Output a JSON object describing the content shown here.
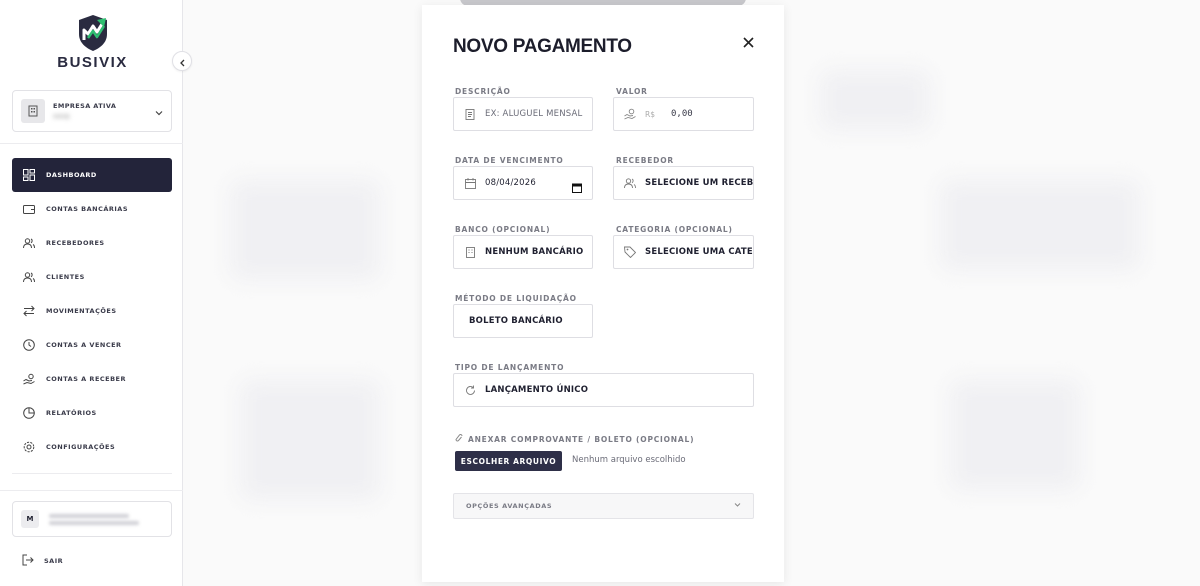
{
  "app": {
    "name": "BUSIVIX"
  },
  "company": {
    "label": "EMPRESA ATIVA",
    "name": "MMB"
  },
  "nav": [
    {
      "label": "DASHBOARD",
      "icon": "dashboard-icon",
      "active": true
    },
    {
      "label": "CONTAS BANCÁRIAS",
      "icon": "wallet-icon"
    },
    {
      "label": "RECEBEDORES",
      "icon": "users-icon"
    },
    {
      "label": "CLIENTES",
      "icon": "users-icon"
    },
    {
      "label": "MOVIMENTAÇÕES",
      "icon": "arrows-icon"
    },
    {
      "label": "CONTAS A VENCER",
      "icon": "clock-icon"
    },
    {
      "label": "CONTAS A RECEBER",
      "icon": "hand-coins-icon"
    },
    {
      "label": "RELATÓRIOS",
      "icon": "pie-chart-icon"
    },
    {
      "label": "CONFIGURAÇÕES",
      "icon": "gear-icon"
    }
  ],
  "user": {
    "initial": "M"
  },
  "logout_label": "SAIR",
  "modal": {
    "title": "NOVO PAGAMENTO",
    "descricao": {
      "label": "DESCRIÇÃO",
      "placeholder": "EX: ALUGUEL MENSAL"
    },
    "valor": {
      "label": "VALOR",
      "currency": "R$",
      "value": "0,00"
    },
    "vencimento": {
      "label": "DATA DE VENCIMENTO",
      "value": "08/04/2026"
    },
    "recebedor": {
      "label": "RECEBEDOR",
      "value": "SELECIONE UM RECEBEDOR"
    },
    "banco": {
      "label": "BANCO (OPCIONAL)",
      "value": "NENHUM BANCÁRIO"
    },
    "categoria": {
      "label": "CATEGORIA (OPCIONAL)",
      "value": "SELECIONE UMA CATEGORIA"
    },
    "metodo": {
      "label": "MÉTODO DE LIQUIDAÇÃO",
      "value": "BOLETO BANCÁRIO"
    },
    "tipo": {
      "label": "TIPO DE LANÇAMENTO",
      "value": "LANÇAMENTO ÚNICO"
    },
    "anexo": {
      "label": "ANEXAR COMPROVANTE / BOLETO (OPCIONAL)",
      "button": "ESCOLHER ARQUIVO",
      "status": "Nenhum arquivo escolhido"
    },
    "advanced": "OPÇÕES AVANÇADAS"
  },
  "colors": {
    "primary": "#23243a",
    "logo_green": "#2fbf71",
    "logo_dark": "#2a2b40"
  }
}
